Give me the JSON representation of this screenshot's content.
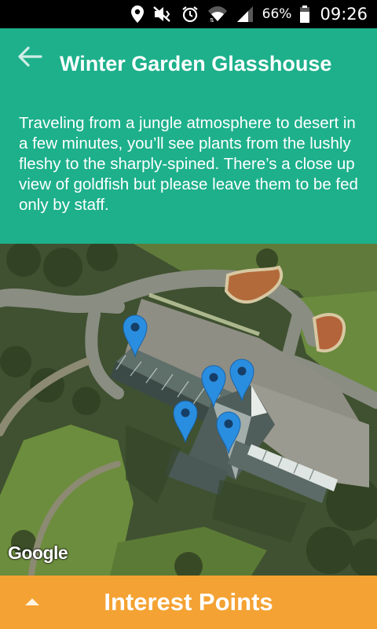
{
  "status_bar": {
    "battery_percent": "66%",
    "time": "09:26",
    "icons": [
      "location-icon",
      "vibrate-mute-icon",
      "alarm-icon",
      "wifi-icon",
      "signal-icon",
      "battery-icon"
    ]
  },
  "header": {
    "back_icon": "arrow-left-icon",
    "title": "Winter Garden Glasshouse",
    "description": "Traveling from a jungle atmosphere to desert in a few minutes, you’ll see plants from the lushly fleshy to the sharply-spined. There’s a close up view of goldfish but please leave them to be fed only by staff.",
    "color": "#1db08b"
  },
  "map": {
    "attribution": "Google",
    "marker_color": "#2a8ee0",
    "marker_count": 5
  },
  "bottom_bar": {
    "label": "Interest Points",
    "icon": "caret-up-icon",
    "color": "#f4a233"
  }
}
